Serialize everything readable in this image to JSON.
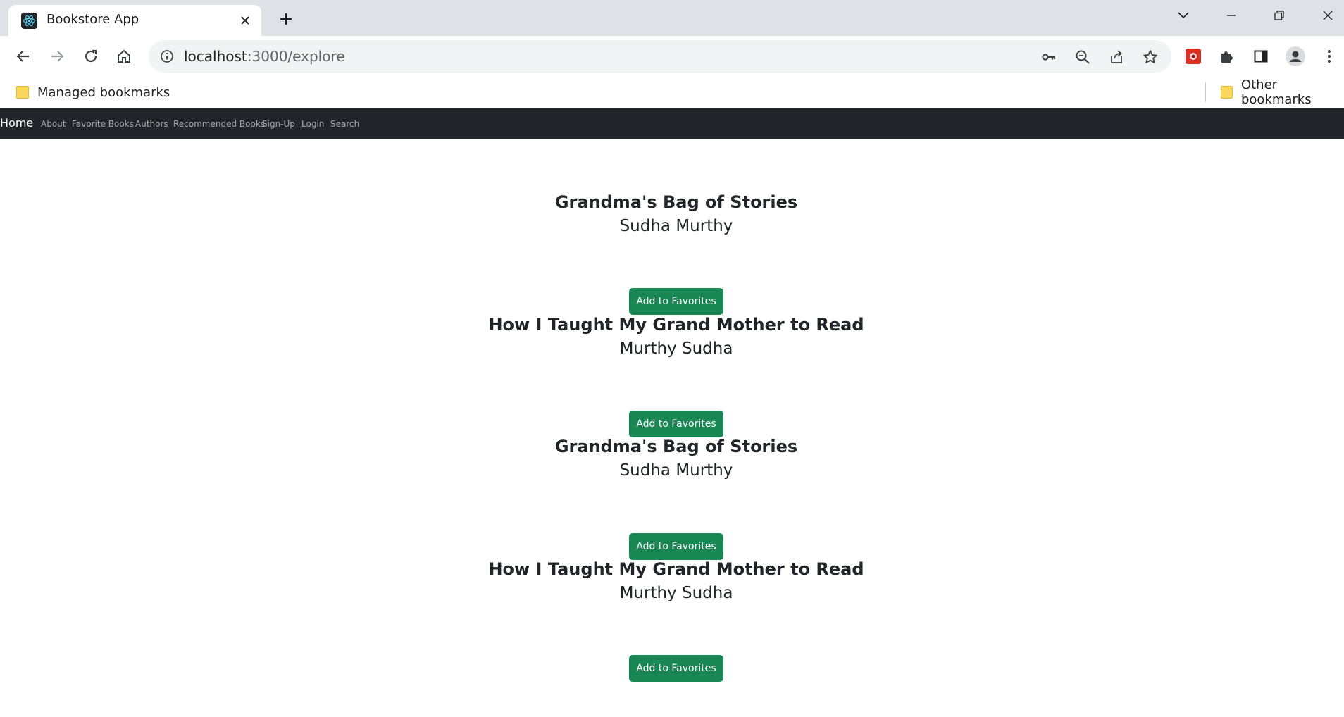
{
  "browser": {
    "tab_title": "Bookstore App",
    "url_host": "localhost",
    "url_rest": ":3000/explore",
    "bookmarks": {
      "managed": "Managed bookmarks",
      "other": "Other bookmarks"
    }
  },
  "navbar": {
    "brand": "Home",
    "links": [
      "About",
      "Favorite Books",
      "Authors",
      "Recommended Books",
      "Sign-Up",
      "Login",
      "Search"
    ]
  },
  "books": [
    {
      "title": "Grandma's Bag of Stories",
      "author": "Sudha Murthy",
      "button": "Add to Favorites"
    },
    {
      "title": "How I Taught My Grand Mother to Read",
      "author": "Murthy Sudha",
      "button": "Add to Favorites"
    },
    {
      "title": "Grandma's Bag of Stories",
      "author": "Sudha Murthy",
      "button": "Add to Favorites"
    },
    {
      "title": "How I Taught My Grand Mother to Read",
      "author": "Murthy Sudha",
      "button": "Add to Favorites"
    },
    {
      "title": "",
      "author": "",
      "button": "Add to Favorites"
    }
  ],
  "colors": {
    "navbar_bg": "#212529",
    "button_bg": "#198754",
    "tabstrip_bg": "#dee1e6"
  }
}
